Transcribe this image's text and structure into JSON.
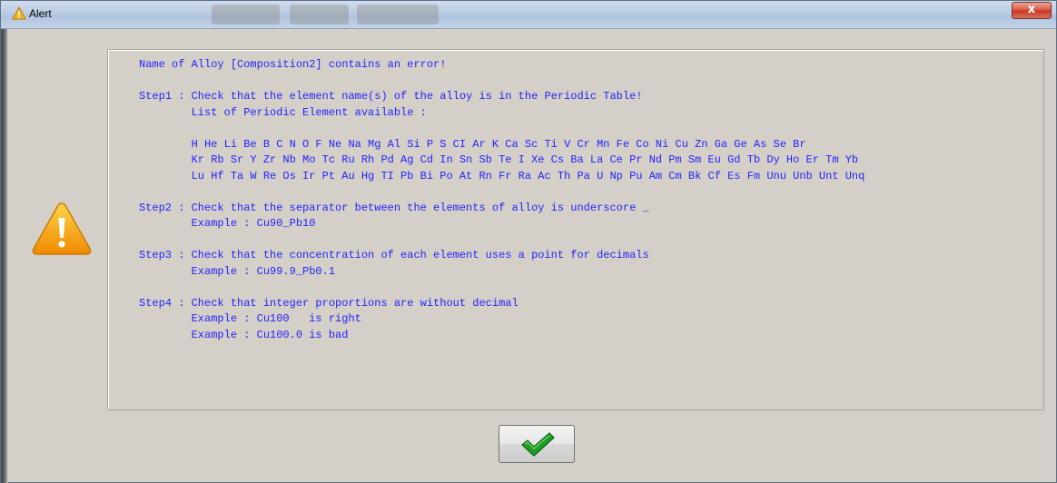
{
  "window": {
    "title": "Alert",
    "close_glyph": "x"
  },
  "message": {
    "lines": [
      "Name of Alloy [Composition2] contains an error!",
      "",
      "Step1 : Check that the element name(s) of the alloy is in the Periodic Table!",
      "        List of Periodic Element available :",
      "",
      "        H He Li Be B C N O F Ne Na Mg Al Si P S CI Ar K Ca Sc Ti V Cr Mn Fe Co Ni Cu Zn Ga Ge As Se Br",
      "        Kr Rb Sr Y Zr Nb Mo Tc Ru Rh Pd Ag Cd In Sn Sb Te I Xe Cs Ba La Ce Pr Nd Pm Sm Eu Gd Tb Dy Ho Er Tm Yb",
      "        Lu Hf Ta W Re Os Ir Pt Au Hg TI Pb Bi Po At Rn Fr Ra Ac Th Pa U Np Pu Am Cm Bk Cf Es Fm Unu Unb Unt Unq",
      "",
      "Step2 : Check that the separator between the elements of alloy is underscore _",
      "        Example : Cu90_Pb10",
      "",
      "Step3 : Check that the concentration of each element uses a point for decimals",
      "        Example : Cu99.9_Pb0.1",
      "",
      "Step4 : Check that integer proportions are without decimal",
      "        Example : Cu100   is right",
      "        Example : Cu100.0 is bad"
    ]
  },
  "icons": {
    "title": "warning-triangle-icon",
    "main": "warning-triangle-icon",
    "ok": "checkmark-icon"
  },
  "colors": {
    "message_text": "#2222ff",
    "checkmark": "#1e9e24",
    "warning": "#f2a50c"
  }
}
